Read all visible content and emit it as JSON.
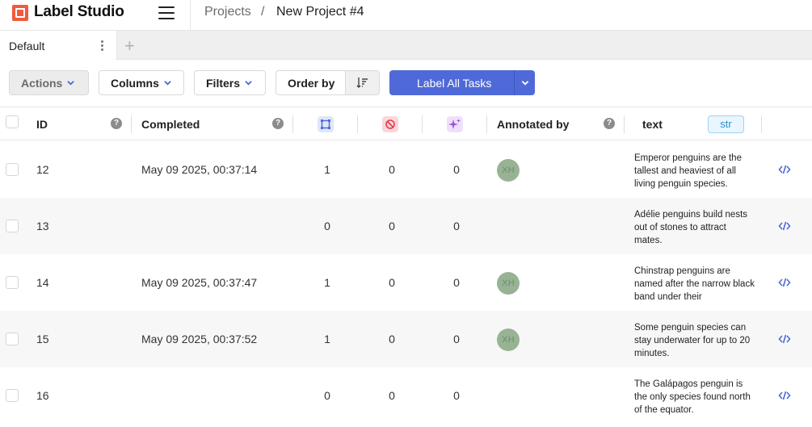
{
  "header": {
    "app_name": "Label Studio",
    "breadcrumb": {
      "projects": "Projects",
      "separator": "/",
      "current": "New Project #4"
    }
  },
  "tabs": [
    {
      "label": "Default"
    }
  ],
  "toolbar": {
    "actions": "Actions",
    "columns": "Columns",
    "filters": "Filters",
    "order_by": "Order by",
    "label_all": "Label All Tasks"
  },
  "table": {
    "headers": {
      "id": "ID",
      "completed": "Completed",
      "annotated_by": "Annotated by",
      "text": "text",
      "text_type": "str"
    },
    "rows": [
      {
        "id": "12",
        "completed": "May 09 2025, 00:37:14",
        "annotations": "1",
        "cancelled": "0",
        "predictions": "0",
        "annotator": "XH",
        "text": "Emperor penguins are the tallest and heaviest of all living penguin species."
      },
      {
        "id": "13",
        "completed": "",
        "annotations": "0",
        "cancelled": "0",
        "predictions": "0",
        "annotator": "",
        "text": "Adélie penguins build nests out of stones to attract mates."
      },
      {
        "id": "14",
        "completed": "May 09 2025, 00:37:47",
        "annotations": "1",
        "cancelled": "0",
        "predictions": "0",
        "annotator": "XH",
        "text": "Chinstrap penguins are named after the narrow black band under their"
      },
      {
        "id": "15",
        "completed": "May 09 2025, 00:37:52",
        "annotations": "1",
        "cancelled": "0",
        "predictions": "0",
        "annotator": "XH",
        "text": "Some penguin species can stay underwater for up to 20 minutes."
      },
      {
        "id": "16",
        "completed": "",
        "annotations": "0",
        "cancelled": "0",
        "predictions": "0",
        "annotator": "",
        "text": "The Galápagos penguin is the only species found north of the equator."
      }
    ]
  },
  "colors": {
    "primary": "#4f6ad8",
    "logo": "#f05a3c",
    "avatar": "#97b394",
    "str_badge": "#2b8fc7"
  },
  "icons": {
    "annotations_header": "annotations-icon",
    "cancelled_header": "cancelled-icon",
    "predictions_header": "predictions-icon",
    "row_action": "code-icon"
  }
}
